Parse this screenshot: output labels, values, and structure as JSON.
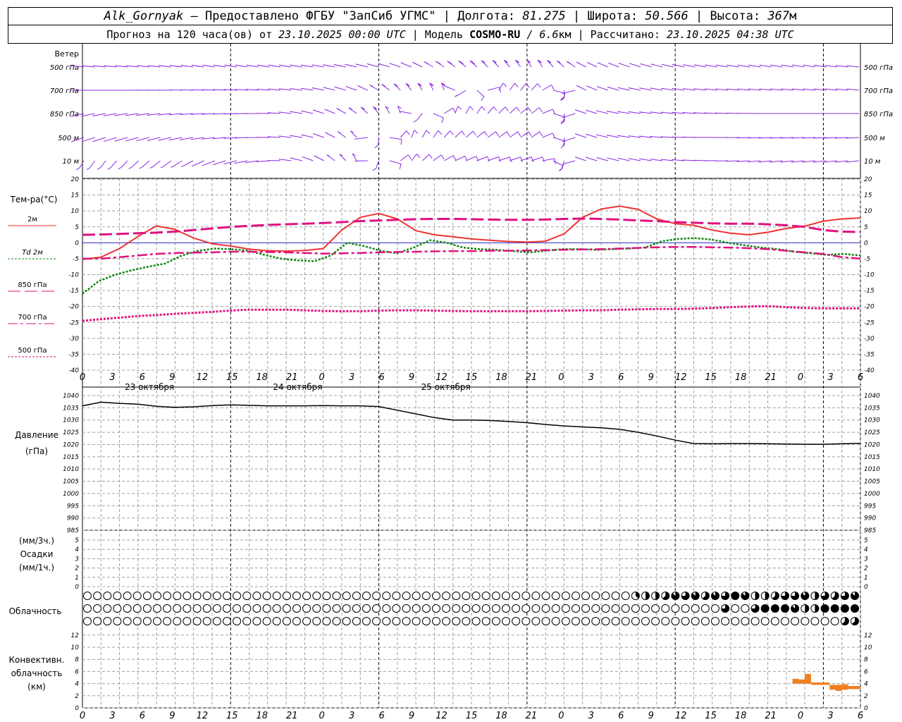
{
  "header": {
    "line1": {
      "station": "Alk_Gornyak",
      "provider": " – Предоставлено ФГБУ \"ЗапСиб УГМС\" | Долгота: ",
      "lon": "81.275",
      "lat_label": " | Широта: ",
      "lat": "50.566",
      "alt_label": " | Высота: ",
      "alt": "367",
      "alt_unit": "м"
    },
    "line2": {
      "prefix": "Прогноз на 120 часа(ов) от ",
      "start": "23.10.2025 00:00 UTC",
      "model_label": "  | Модель ",
      "model": "COSMO-RU",
      "res": " / 6.6",
      "res_unit": "км",
      "calc_label": " | Рассчитано: ",
      "calc": "23.10.2025 04:38 UTC"
    }
  },
  "labels": {
    "wind": "Ветер",
    "wind_levels": [
      "500 гПа",
      "700 гПа",
      "850 гПа",
      "500 м",
      "10  м"
    ],
    "temp": "Тем-ра(°C)",
    "legend": [
      "2м",
      "Td  2м",
      "850 гПа",
      "700 гПа",
      "500 гПа"
    ],
    "pressure": [
      "Давление",
      "(гПа)"
    ],
    "precip": [
      "(мм/3ч.)",
      "Осадки",
      "(мм/1ч.)"
    ],
    "cloud": "Облачность",
    "conv": [
      "Конвективн.",
      "облачность",
      "(км)"
    ],
    "days": [
      "23 октября",
      "24 октября",
      "25 октября"
    ]
  },
  "colors": {
    "wind": "#8a2be2",
    "t2m": "#ee3333",
    "td2m": "#118811",
    "t850": "#e0117f",
    "t700": "#e0117f",
    "t500": "#e0117f",
    "zero": "#3333cc",
    "conv": "#f08020",
    "grid": "#a0a0a0"
  },
  "chart_data": [
    {
      "type": "wind_barbs",
      "levels": [
        "500 гПа",
        "700 гПа",
        "850 гПа",
        "500 м",
        "10  м"
      ],
      "x_hours": [
        0,
        126
      ],
      "note_levels_speed_ms": [
        [
          25,
          25,
          25,
          25,
          24,
          22,
          20,
          18,
          15,
          12,
          10,
          9,
          9,
          8,
          9,
          11,
          12,
          12
        ],
        [
          22,
          22,
          21,
          20,
          18,
          15,
          12,
          10,
          8,
          7,
          7,
          8,
          9,
          10,
          12,
          13,
          13,
          13
        ],
        [
          15,
          15,
          14,
          13,
          12,
          10,
          8,
          7,
          6,
          6,
          7,
          8,
          10,
          12,
          14,
          16,
          16,
          16
        ],
        [
          12,
          12,
          11,
          10,
          9,
          8,
          6,
          5,
          5,
          5,
          6,
          8,
          10,
          12,
          14,
          14,
          14,
          14
        ],
        [
          6,
          6,
          6,
          5,
          5,
          4,
          4,
          3,
          3,
          3,
          4,
          5,
          6,
          7,
          8,
          8,
          8,
          8
        ]
      ],
      "note_levels_dir_deg": [
        [
          280,
          280,
          282,
          285,
          285,
          285,
          290,
          300,
          320,
          330,
          340,
          310,
          300,
          290,
          285,
          285,
          285,
          280
        ],
        [
          270,
          270,
          272,
          275,
          278,
          285,
          300,
          330,
          350,
          20,
          30,
          310,
          290,
          285,
          280,
          280,
          280,
          280
        ],
        [
          250,
          255,
          260,
          265,
          270,
          290,
          320,
          350,
          10,
          30,
          40,
          300,
          285,
          280,
          275,
          270,
          270,
          270
        ],
        [
          240,
          245,
          250,
          260,
          270,
          290,
          330,
          10,
          30,
          40,
          40,
          300,
          285,
          275,
          270,
          265,
          265,
          265
        ],
        [
          200,
          210,
          220,
          240,
          260,
          300,
          340,
          20,
          50,
          60,
          60,
          300,
          290,
          280,
          270,
          260,
          260,
          260
        ]
      ]
    },
    {
      "type": "line",
      "title": "Тем-ра(°C)",
      "ylim": [
        -40,
        20
      ],
      "x_hours": [
        0,
        3,
        6,
        9,
        12,
        15,
        18,
        21,
        24,
        27,
        30,
        33,
        36,
        39,
        42,
        45,
        48,
        51,
        54,
        57,
        60,
        63,
        66,
        69,
        72,
        75,
        78,
        81,
        84,
        87,
        90,
        93,
        96,
        99,
        102,
        105,
        108,
        111,
        114,
        117,
        120,
        123,
        126
      ],
      "series": [
        {
          "name": "2м",
          "values": [
            -5.2,
            -4.5,
            -1.8,
            2,
            5.3,
            4.2,
            1.5,
            -0.3,
            -1,
            -2,
            -2.5,
            -2.6,
            -2.4,
            -1.8,
            4,
            8,
            9.2,
            7.5,
            3.8,
            2.5,
            1.9,
            1.2,
            0.8,
            0.4,
            0.2,
            0.5,
            2.8,
            8,
            10.6,
            11.5,
            10.5,
            7.5,
            6,
            5.5,
            4,
            3,
            2.5,
            3.3,
            4.5,
            5.2,
            6.8,
            7.5,
            7.8
          ]
        },
        {
          "name": "Td 2м",
          "values": [
            -16,
            -12,
            -10,
            -8.6,
            -7.5,
            -6.5,
            -4,
            -2.5,
            -1.8,
            -2,
            -2.5,
            -3.8,
            -5,
            -5.5,
            -5.8,
            -4,
            0,
            -1,
            -2.5,
            -3.3,
            -1.5,
            0.8,
            0,
            -1.5,
            -2,
            -2.2,
            -2.6,
            -3,
            -2.5,
            -2,
            -2,
            -2.2,
            -2,
            -1.8,
            -1.5,
            0.5,
            1.2,
            1.5,
            1,
            0,
            -0.8,
            -1.5,
            -2,
            -2.8,
            -3.3,
            -3.8,
            -3.5,
            -4
          ]
        },
        {
          "name": "850 гПа",
          "values": [
            2.5,
            2.6,
            2.8,
            3,
            3.2,
            3.5,
            4,
            4.5,
            5,
            5.3,
            5.6,
            5.8,
            6,
            6.2,
            6.5,
            6.8,
            7,
            7.2,
            7.4,
            7.5,
            7.5,
            7.4,
            7.3,
            7.2,
            7.2,
            7.3,
            7.5,
            7.6,
            7.5,
            7.3,
            7.0,
            6.8,
            6.5,
            6.3,
            6.1,
            6.0,
            6.0,
            5.8,
            5.5,
            5,
            4,
            3.5,
            3.4
          ]
        },
        {
          "name": "700 гПа",
          "values": [
            -5,
            -5,
            -4.5,
            -4,
            -3.5,
            -3.2,
            -3.1,
            -3,
            -2.8,
            -2.8,
            -2.9,
            -3,
            -3.2,
            -3.4,
            -3.3,
            -3.2,
            -3,
            -2.9,
            -2.8,
            -2.7,
            -2.6,
            -2.6,
            -2.5,
            -2.5,
            -2.4,
            -2.3,
            -2.2,
            -2.1,
            -2.0,
            -1.8,
            -1.6,
            -1.4,
            -1.3,
            -1.3,
            -1.4,
            -1.5,
            -1.7,
            -2,
            -2.5,
            -3,
            -3.5,
            -4.5,
            -5
          ]
        },
        {
          "name": "500 гПа",
          "values": [
            -24.5,
            -24,
            -23.5,
            -23,
            -22.7,
            -22.3,
            -22,
            -21.7,
            -21.3,
            -21,
            -21,
            -21,
            -21.2,
            -21.4,
            -21.5,
            -21.5,
            -21.3,
            -21.2,
            -21.2,
            -21.3,
            -21.4,
            -21.5,
            -21.5,
            -21.5,
            -21.5,
            -21.4,
            -21.3,
            -21.2,
            -21.2,
            -21.0,
            -20.9,
            -20.8,
            -20.8,
            -20.7,
            -20.5,
            -20.2,
            -20,
            -19.9,
            -20.2,
            -20.5,
            -20.6,
            -20.6,
            -20.6
          ]
        }
      ]
    },
    {
      "type": "line",
      "title": "Давление (гПа)",
      "ylim": [
        985,
        1040
      ],
      "x_hours": [
        0,
        3,
        6,
        9,
        12,
        15,
        18,
        21,
        24,
        27,
        30,
        33,
        36,
        39,
        42,
        45,
        48,
        51,
        54,
        57,
        60,
        63,
        66,
        69,
        72,
        75,
        78,
        81,
        84,
        87,
        90,
        93,
        96,
        99,
        102,
        105,
        108,
        111,
        114,
        117,
        120,
        123,
        126
      ],
      "values": [
        1035.8,
        1037.3,
        1036.8,
        1036.5,
        1035.6,
        1035.2,
        1035.4,
        1035.9,
        1036.2,
        1036,
        1035.8,
        1035.8,
        1035.8,
        1035.9,
        1035.8,
        1035.8,
        1035.5,
        1034,
        1032.5,
        1031,
        1030,
        1030,
        1029.8,
        1029.4,
        1028.9,
        1028.2,
        1027.6,
        1027.2,
        1026.8,
        1026.2,
        1025,
        1023.5,
        1021.8,
        1020.4,
        1020.3,
        1020.4,
        1020.4,
        1020.3,
        1020.2,
        1020.1,
        1020.1,
        1020.3,
        1020.5
      ]
    },
    {
      "type": "bar",
      "title": "Осадки (мм/3ч.) (мм/1ч.)",
      "ylim": [
        0,
        5
      ],
      "values": []
    },
    {
      "type": "table",
      "title": "Облачность",
      "levels": [
        "upper",
        "middle",
        "lower"
      ],
      "note": "cloud fraction in eighths per hourly step (0=clear, 8=overcast)",
      "upper_start_hour": 89,
      "upper": [
        3,
        2,
        4,
        2,
        4,
        5,
        6,
        7,
        6,
        6,
        7,
        6,
        5,
        7,
        7,
        6,
        8,
        8,
        7,
        6,
        4,
        4,
        4,
        5,
        4,
        6,
        5,
        6,
        7,
        4,
        4,
        5,
        6,
        5,
        6,
        6,
        7
      ],
      "middle_start_hour": 104,
      "middle": [
        6,
        0,
        0,
        0,
        0,
        0,
        3,
        6,
        0,
        8,
        8,
        8,
        8,
        8,
        8,
        7,
        1,
        4,
        5,
        4,
        8,
        8,
        8,
        8,
        8,
        8,
        8,
        8
      ],
      "lower_start_hour": 124,
      "lower": [
        5,
        0,
        5
      ]
    },
    {
      "type": "bar",
      "title": "Конвективн. облачность (км)",
      "ylim": [
        0,
        13
      ],
      "segments": [
        {
          "h0": 115,
          "h1": 116,
          "bottom": 4,
          "top": 4.8
        },
        {
          "h0": 116,
          "h1": 117,
          "bottom": 4,
          "top": 4.7
        },
        {
          "h0": 117,
          "h1": 118,
          "bottom": 4,
          "top": 5.6
        },
        {
          "h0": 118,
          "h1": 121,
          "bottom": 3.8,
          "top": 4.2
        },
        {
          "h0": 121,
          "h1": 122,
          "bottom": 3,
          "top": 3.8
        },
        {
          "h0": 122,
          "h1": 123,
          "bottom": 2.8,
          "top": 3.8
        },
        {
          "h0": 123,
          "h1": 124,
          "bottom": 3,
          "top": 3.9
        },
        {
          "h0": 124,
          "h1": 126,
          "bottom": 3.1,
          "top": 3.6
        }
      ]
    }
  ],
  "axis": {
    "hour_ticks": [
      "0",
      "3",
      "6",
      "9",
      "12",
      "15",
      "18",
      "21",
      "0",
      "3",
      "6",
      "9",
      "12",
      "15",
      "18",
      "21",
      "0",
      "3",
      "6",
      "9",
      "12",
      "15",
      "18",
      "21",
      "0",
      "3",
      "6"
    ],
    "temp_ticks": [
      "20",
      "15",
      "10",
      "5",
      "0",
      "-5",
      "-10",
      "-15",
      "-20",
      "-25",
      "-30",
      "-35",
      "-40"
    ],
    "pressure_ticks": [
      "1040",
      "1035",
      "1030",
      "1025",
      "1020",
      "1015",
      "1010",
      "1005",
      "1000",
      "995",
      "990",
      "985"
    ],
    "precip_ticks": [
      "5",
      "4",
      "3",
      "2",
      "1",
      "0"
    ],
    "conv_ticks": [
      "12",
      "10",
      "8",
      "6",
      "4",
      "2",
      "0"
    ]
  }
}
